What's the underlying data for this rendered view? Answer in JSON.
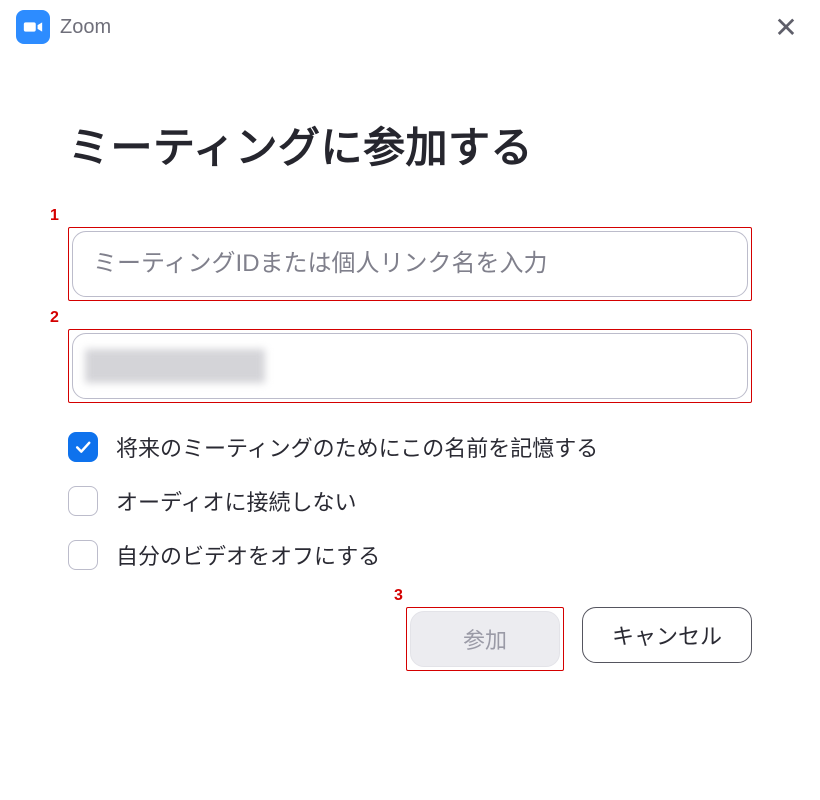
{
  "app": {
    "title": "Zoom"
  },
  "dialog": {
    "heading": "ミーティングに参加する",
    "meeting_id_placeholder": "ミーティングIDまたは個人リンク名を入力",
    "name_value": "",
    "options": {
      "remember_name": {
        "label": "将来のミーティングのためにこの名前を記憶する",
        "checked": true
      },
      "no_audio": {
        "label": "オーディオに接続しない",
        "checked": false
      },
      "video_off": {
        "label": "自分のビデオをオフにする",
        "checked": false
      }
    },
    "buttons": {
      "join": "参加",
      "cancel": "キャンセル"
    }
  },
  "annotations": {
    "a1": "1",
    "a2": "2",
    "a3": "3"
  }
}
